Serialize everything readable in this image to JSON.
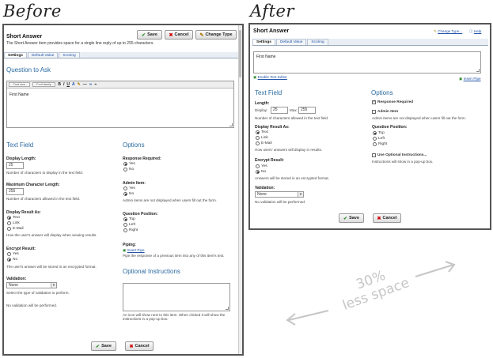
{
  "headings": {
    "before": "Before",
    "after": "After"
  },
  "before": {
    "title": "Short Answer",
    "description": "The Short Answer item provides space for a single line reply of up to 255 characters.",
    "buttons": {
      "save": "Save",
      "cancel": "Cancel",
      "change_type": "Change Type"
    },
    "tabs": [
      "Settings",
      "Default Value",
      "Scoring"
    ],
    "question_heading": "Question to Ask",
    "editor": {
      "font_size": "-- Font size --",
      "font_family": "-- Font family --",
      "text": "First Name"
    },
    "text_field_heading": "Text Field",
    "display_length": {
      "label": "Display Length:",
      "value": "25",
      "help": "Number of characters to display in the text field."
    },
    "max_length": {
      "label": "Maximum Character Length:",
      "value": "255",
      "help": "Number of characters allowed in the text field."
    },
    "display_result": {
      "label": "Display Result As:",
      "options": [
        "Text",
        "Link",
        "E-Mail"
      ],
      "selected": "Text",
      "help": "How the user's answer will display when viewing results."
    },
    "encrypt": {
      "label": "Encrypt Result:",
      "options": [
        "Yes",
        "No"
      ],
      "selected": "No",
      "help": "The user's answer will be stored in an encrypted format."
    },
    "validation": {
      "label": "Validation:",
      "value": "None",
      "help1": "Select the type of validation to perform.",
      "help2": "No validation will be performed."
    },
    "options_heading": "Options",
    "response_required": {
      "label": "Response Required:",
      "options": [
        "Yes",
        "No"
      ],
      "selected": "Yes"
    },
    "admin_item": {
      "label": "Admin Item:",
      "options": [
        "Yes",
        "No"
      ],
      "selected": "No",
      "help": "Admin items are not displayed when users fill out the form."
    },
    "question_position": {
      "label": "Question Position:",
      "options": [
        "Top",
        "Left",
        "Right"
      ],
      "selected": "Top"
    },
    "piping": {
      "label": "Piping:",
      "link": "Insert Pipe",
      "help": "Pipe the response of a previous item into any of this item's text."
    },
    "optional_heading": "Optional Instructions",
    "optional_help": "An icon will show next to this item. When clicked it will show the instructions in a pop-up box.",
    "bottom_buttons": {
      "save": "Save",
      "cancel": "Cancel"
    }
  },
  "after": {
    "title": "Short Answer",
    "change_type": "Change Type...",
    "help": "Help",
    "tabs": [
      "Settings",
      "Default Value",
      "Scoring"
    ],
    "question_text": "First Name",
    "enable_editor": "Enable Text Editor",
    "insert_pipe": "Insert Pipe",
    "text_field_heading": "Text Field",
    "length": {
      "label": "Length:",
      "display_label": "Display:",
      "display_value": "25",
      "max_label": "Max:",
      "max_value": "255",
      "help": "Number of characters allowed in the text field."
    },
    "display_result": {
      "label": "Display Result As:",
      "options": [
        "Text",
        "Link",
        "E-Mail"
      ],
      "selected": "Text",
      "help": "How users' answers will display in results."
    },
    "encrypt": {
      "label": "Encrypt Result:",
      "options": [
        "Yes",
        "No"
      ],
      "selected": "No",
      "help": "Answers will be stored in an encrypted format."
    },
    "validation": {
      "label": "Validation:",
      "value": "None",
      "help": "No validation will be performed."
    },
    "options_heading": "Options",
    "response_required": {
      "label": "Response Required",
      "checked": true
    },
    "admin_item": {
      "label": "Admin Item",
      "checked": false,
      "help": "Admin items are not displayed when users fill out the form."
    },
    "question_position": {
      "label": "Question Position:",
      "options": [
        "Top",
        "Left",
        "Right"
      ],
      "selected": "Top"
    },
    "optional_instructions": {
      "label": "Use Optional Instructions...",
      "checked": false,
      "help": "Instructions will show in a pop-up box."
    },
    "buttons": {
      "save": "Save",
      "cancel": "Cancel"
    }
  },
  "promo": {
    "line1": "30%",
    "line2": "less space"
  }
}
